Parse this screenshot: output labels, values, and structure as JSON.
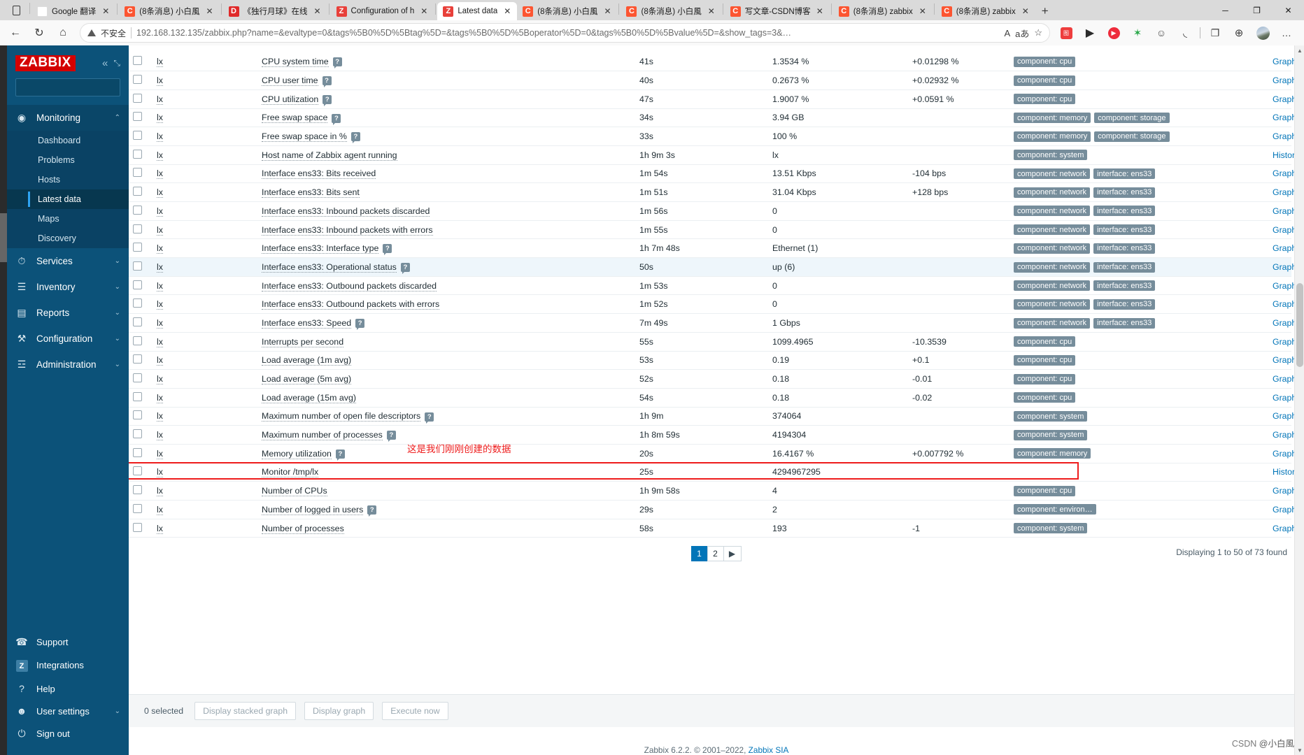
{
  "browser": {
    "tabs": [
      {
        "favicon": "google-translate-icon",
        "fav_class": "fav-g",
        "fav_text": "G",
        "title": "Google 翻译",
        "active": false
      },
      {
        "favicon": "csdn-icon",
        "fav_class": "fav-c",
        "fav_text": "C",
        "title": "(8条消息) 小白風",
        "active": false
      },
      {
        "favicon": "bilibili-icon",
        "fav_class": "fav-b",
        "fav_text": "D",
        "title": "《独行月球》在线",
        "active": false
      },
      {
        "favicon": "zabbix-icon",
        "fav_class": "fav-z",
        "fav_text": "Z",
        "title": "Configuration of h",
        "active": false
      },
      {
        "favicon": "zabbix-icon",
        "fav_class": "fav-z",
        "fav_text": "Z",
        "title": "Latest data",
        "active": true
      },
      {
        "favicon": "csdn-icon",
        "fav_class": "fav-c",
        "fav_text": "C",
        "title": "(8条消息) 小白風",
        "active": false
      },
      {
        "favicon": "csdn-icon",
        "fav_class": "fav-c",
        "fav_text": "C",
        "title": "(8条消息) 小白風",
        "active": false
      },
      {
        "favicon": "csdn-icon",
        "fav_class": "fav-c",
        "fav_text": "C",
        "title": "写文章-CSDN博客",
        "active": false
      },
      {
        "favicon": "csdn-icon",
        "fav_class": "fav-c",
        "fav_text": "C",
        "title": "(8条消息) zabbix",
        "active": false
      },
      {
        "favicon": "csdn-icon",
        "fav_class": "fav-c",
        "fav_text": "C",
        "title": "(8条消息) zabbix",
        "active": false
      }
    ],
    "new_tab_label": "+",
    "window_controls": {
      "minimize": "─",
      "maximize": "❐",
      "close": "✕"
    },
    "nav": {
      "back": "←",
      "reload": "↻",
      "home": "⌂"
    },
    "security_label": "不安全",
    "url": "192.168.132.135/zabbix.php?name=&evaltype=0&tags%5B0%5D%5Btag%5D=&tags%5B0%5D%5Boperator%5D=0&tags%5B0%5D%5Bvalue%5D=&show_tags=3&…",
    "url_host": "192.168.132.135",
    "read_aloud_icon": "A",
    "translate_icon": "aあ",
    "favorite_icon": "☆",
    "collections_icon": "❐",
    "more_icon": "…"
  },
  "sidebar": {
    "logo": "ZABBIX",
    "collapse_icon": "«",
    "expand_icon": "⤡",
    "search_placeholder": "",
    "search_value": "",
    "search_icon": "⌕",
    "groups": [
      {
        "label": "Monitoring",
        "icon": "eye-icon",
        "icon_glyph": "◉",
        "expanded": true,
        "caret": "⌃",
        "items": [
          {
            "label": "Dashboard",
            "active": false
          },
          {
            "label": "Problems",
            "active": false
          },
          {
            "label": "Hosts",
            "active": false
          },
          {
            "label": "Latest data",
            "active": true
          },
          {
            "label": "Maps",
            "active": false
          },
          {
            "label": "Discovery",
            "active": false
          }
        ]
      },
      {
        "label": "Services",
        "icon": "stopwatch-icon",
        "icon_glyph": "⏱",
        "expanded": false,
        "caret": "⌄",
        "items": []
      },
      {
        "label": "Inventory",
        "icon": "list-icon",
        "icon_glyph": "☰",
        "expanded": false,
        "caret": "⌄",
        "items": []
      },
      {
        "label": "Reports",
        "icon": "bar-chart-icon",
        "icon_glyph": "▤",
        "expanded": false,
        "caret": "⌄",
        "items": []
      },
      {
        "label": "Configuration",
        "icon": "wrench-icon",
        "icon_glyph": "⚒",
        "expanded": false,
        "caret": "⌄",
        "items": []
      },
      {
        "label": "Administration",
        "icon": "sliders-icon",
        "icon_glyph": "☲",
        "expanded": false,
        "caret": "⌄",
        "items": []
      }
    ],
    "footer_items": [
      {
        "label": "Support",
        "icon": "headset-icon",
        "icon_glyph": "☎",
        "caret": ""
      },
      {
        "label": "Integrations",
        "icon": "zabbix-z-icon",
        "icon_glyph": "Z",
        "caret": ""
      },
      {
        "label": "Help",
        "icon": "question-icon",
        "icon_glyph": "?",
        "caret": ""
      },
      {
        "label": "User settings",
        "icon": "user-icon",
        "icon_glyph": "☻",
        "caret": "⌄"
      },
      {
        "label": "Sign out",
        "icon": "power-icon",
        "icon_glyph": "⏻",
        "caret": ""
      }
    ]
  },
  "table": {
    "rows": [
      {
        "host": "lx",
        "name": "CPU system time",
        "hint": true,
        "interval": "41s",
        "value": "1.3534 %",
        "change": "+0.01298 %",
        "tags": [
          "component: cpu"
        ],
        "action": "Graph"
      },
      {
        "host": "lx",
        "name": "CPU user time",
        "hint": true,
        "interval": "40s",
        "value": "0.2673 %",
        "change": "+0.02932 %",
        "tags": [
          "component: cpu"
        ],
        "action": "Graph"
      },
      {
        "host": "lx",
        "name": "CPU utilization",
        "hint": true,
        "interval": "47s",
        "value": "1.9007 %",
        "change": "+0.0591 %",
        "tags": [
          "component: cpu"
        ],
        "action": "Graph"
      },
      {
        "host": "lx",
        "name": "Free swap space",
        "hint": true,
        "interval": "34s",
        "value": "3.94 GB",
        "change": "",
        "tags": [
          "component: memory",
          "component: storage"
        ],
        "action": "Graph"
      },
      {
        "host": "lx",
        "name": "Free swap space in %",
        "hint": true,
        "interval": "33s",
        "value": "100 %",
        "change": "",
        "tags": [
          "component: memory",
          "component: storage"
        ],
        "action": "Graph"
      },
      {
        "host": "lx",
        "name": "Host name of Zabbix agent running",
        "hint": false,
        "interval": "1h 9m 3s",
        "value": "lx",
        "change": "",
        "tags": [
          "component: system"
        ],
        "action": "History"
      },
      {
        "host": "lx",
        "name": "Interface ens33: Bits received",
        "hint": false,
        "interval": "1m 54s",
        "value": "13.51 Kbps",
        "change": "-104 bps",
        "tags": [
          "component: network",
          "interface: ens33"
        ],
        "action": "Graph"
      },
      {
        "host": "lx",
        "name": "Interface ens33: Bits sent",
        "hint": false,
        "interval": "1m 51s",
        "value": "31.04 Kbps",
        "change": "+128 bps",
        "tags": [
          "component: network",
          "interface: ens33"
        ],
        "action": "Graph"
      },
      {
        "host": "lx",
        "name": "Interface ens33: Inbound packets discarded",
        "hint": false,
        "interval": "1m 56s",
        "value": "0",
        "change": "",
        "tags": [
          "component: network",
          "interface: ens33"
        ],
        "action": "Graph"
      },
      {
        "host": "lx",
        "name": "Interface ens33: Inbound packets with errors",
        "hint": false,
        "interval": "1m 55s",
        "value": "0",
        "change": "",
        "tags": [
          "component: network",
          "interface: ens33"
        ],
        "action": "Graph"
      },
      {
        "host": "lx",
        "name": "Interface ens33: Interface type",
        "hint": true,
        "interval": "1h 7m 48s",
        "value": "Ethernet (1)",
        "change": "",
        "tags": [
          "component: network",
          "interface: ens33"
        ],
        "action": "Graph"
      },
      {
        "host": "lx",
        "name": "Interface ens33: Operational status",
        "hint": true,
        "interval": "50s",
        "value": "up (6)",
        "change": "",
        "tags": [
          "component: network",
          "interface: ens33"
        ],
        "action": "Graph",
        "alt": true
      },
      {
        "host": "lx",
        "name": "Interface ens33: Outbound packets discarded",
        "hint": false,
        "interval": "1m 53s",
        "value": "0",
        "change": "",
        "tags": [
          "component: network",
          "interface: ens33"
        ],
        "action": "Graph"
      },
      {
        "host": "lx",
        "name": "Interface ens33: Outbound packets with errors",
        "hint": false,
        "interval": "1m 52s",
        "value": "0",
        "change": "",
        "tags": [
          "component: network",
          "interface: ens33"
        ],
        "action": "Graph"
      },
      {
        "host": "lx",
        "name": "Interface ens33: Speed",
        "hint": true,
        "interval": "7m 49s",
        "value": "1 Gbps",
        "change": "",
        "tags": [
          "component: network",
          "interface: ens33"
        ],
        "action": "Graph"
      },
      {
        "host": "lx",
        "name": "Interrupts per second",
        "hint": false,
        "interval": "55s",
        "value": "1099.4965",
        "change": "-10.3539",
        "tags": [
          "component: cpu"
        ],
        "action": "Graph"
      },
      {
        "host": "lx",
        "name": "Load average (1m avg)",
        "hint": false,
        "interval": "53s",
        "value": "0.19",
        "change": "+0.1",
        "tags": [
          "component: cpu"
        ],
        "action": "Graph"
      },
      {
        "host": "lx",
        "name": "Load average (5m avg)",
        "hint": false,
        "interval": "52s",
        "value": "0.18",
        "change": "-0.01",
        "tags": [
          "component: cpu"
        ],
        "action": "Graph"
      },
      {
        "host": "lx",
        "name": "Load average (15m avg)",
        "hint": false,
        "interval": "54s",
        "value": "0.18",
        "change": "-0.02",
        "tags": [
          "component: cpu"
        ],
        "action": "Graph"
      },
      {
        "host": "lx",
        "name": "Maximum number of open file descriptors",
        "hint": true,
        "interval": "1h 9m",
        "value": "374064",
        "change": "",
        "tags": [
          "component: system"
        ],
        "action": "Graph"
      },
      {
        "host": "lx",
        "name": "Maximum number of processes",
        "hint": true,
        "interval": "1h 8m 59s",
        "value": "4194304",
        "change": "",
        "tags": [
          "component: system"
        ],
        "action": "Graph"
      },
      {
        "host": "lx",
        "name": "Memory utilization",
        "hint": true,
        "interval": "20s",
        "value": "16.4167 %",
        "change": "+0.007792 %",
        "tags": [
          "component: memory"
        ],
        "action": "Graph"
      },
      {
        "host": "lx",
        "name": "Monitor /tmp/lx",
        "hint": false,
        "interval": "25s",
        "value": "4294967295",
        "change": "",
        "tags": [],
        "action": "History",
        "highlight": true
      },
      {
        "host": "lx",
        "name": "Number of CPUs",
        "hint": false,
        "interval": "1h 9m 58s",
        "value": "4",
        "change": "",
        "tags": [
          "component: cpu"
        ],
        "action": "Graph"
      },
      {
        "host": "lx",
        "name": "Number of logged in users",
        "hint": true,
        "interval": "29s",
        "value": "2",
        "change": "",
        "tags": [
          "component: environ…"
        ],
        "action": "Graph"
      },
      {
        "host": "lx",
        "name": "Number of processes",
        "hint": false,
        "interval": "58s",
        "value": "193",
        "change": "-1",
        "tags": [
          "component: system"
        ],
        "action": "Graph"
      }
    ]
  },
  "annotation": {
    "text": "这是我们刚刚创建的数据",
    "color": "#ee1c1c"
  },
  "pagination": {
    "pages": [
      "1",
      "2"
    ],
    "active": "1",
    "next_icon": "▶",
    "summary": "Displaying 1 to 50 of 73 found"
  },
  "footer_actions": {
    "selected_label": "0 selected",
    "buttons": [
      "Display stacked graph",
      "Display graph",
      "Execute now"
    ]
  },
  "zabbix_footer": {
    "text": "Zabbix 6.2.2. © 2001–2022, ",
    "link": "Zabbix SIA"
  },
  "watermark": {
    "prefix": "CSDN ",
    "text": "@小白風"
  }
}
